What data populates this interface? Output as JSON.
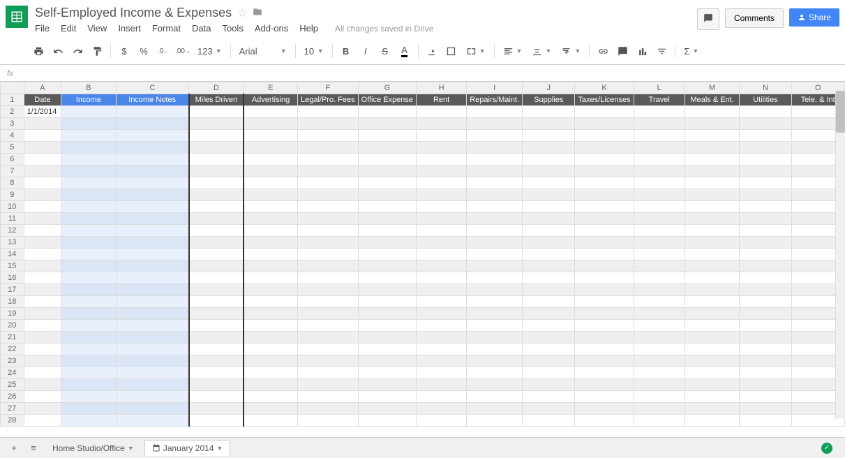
{
  "doc": {
    "title": "Self-Employed Income & Expenses",
    "save_status": "All changes saved in Drive"
  },
  "menus": [
    "File",
    "Edit",
    "View",
    "Insert",
    "Format",
    "Data",
    "Tools",
    "Add-ons",
    "Help"
  ],
  "header_buttons": {
    "comments": "Comments",
    "share": "Share"
  },
  "toolbar": {
    "currency": "$",
    "percent": "%",
    "dec_dec": ".0",
    "dec_inc": ".00",
    "more_formats": "123",
    "font": "Arial",
    "font_size": "10"
  },
  "formula_bar": {
    "fx": "fx",
    "value": ""
  },
  "columns": [
    "A",
    "B",
    "C",
    "D",
    "E",
    "F",
    "G",
    "H",
    "I",
    "J",
    "K",
    "L",
    "M",
    "N",
    "O"
  ],
  "row_count": 28,
  "headers_row1": {
    "A": "Date",
    "B": "Income",
    "C": "Income Notes",
    "D": "Miles Driven",
    "E": "Advertising",
    "F": "Legal/Pro. Fees",
    "G": "Office Expense",
    "H": "Rent",
    "I": "Repairs/Maint.",
    "J": "Supplies",
    "K": "Taxes/Licenses",
    "L": "Travel",
    "M": "Meals & Ent.",
    "N": "Utilities",
    "O": "Tele. & Int"
  },
  "data": {
    "A2": "1/1/2014"
  },
  "sheets": {
    "tab1": "Home Studio/Office",
    "tab2": "January 2014"
  }
}
